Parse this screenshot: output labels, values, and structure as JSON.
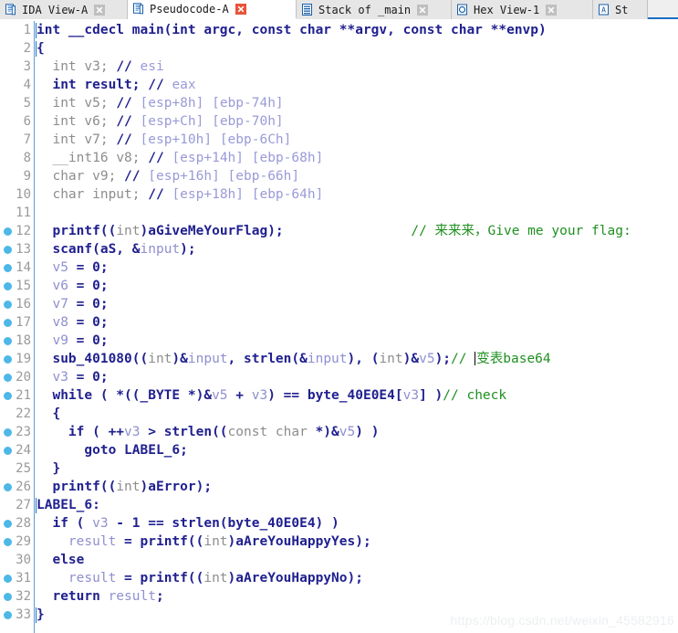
{
  "tabs": [
    {
      "label": "IDA View-A",
      "icon": "document-icon",
      "active": false,
      "close": "close-icon",
      "close_style": "gray",
      "width": 140
    },
    {
      "label": "Pseudocode-A",
      "icon": "document-icon",
      "active": true,
      "close": "close-icon",
      "close_style": "red",
      "width": 185
    },
    {
      "label": "Stack of _main",
      "icon": "stack-icon",
      "active": false,
      "close": "close-icon",
      "close_style": "gray",
      "width": 170
    },
    {
      "label": "Hex View-1",
      "icon": "hex-icon",
      "active": false,
      "close": "close-icon",
      "close_style": "gray",
      "width": 155
    },
    {
      "label": "St",
      "icon": "structures-icon",
      "active": false,
      "close": "",
      "close_style": "none",
      "width": 60
    }
  ],
  "colors": {
    "accent": "#1a6fc4",
    "breakpoint": "#4db8e8",
    "comment": "#1f9020",
    "keyword": "#202090",
    "variable": "#8f8fd0",
    "dim": "#8d8d8d",
    "linenum": "#9a9a9a",
    "gutter_rule": "#5b9bd5",
    "tab_active_bg": "#ffffff",
    "tab_inactive_bg": "#e6e6e6",
    "watermark": "#eceff1"
  },
  "watermark": "https://blog.csdn.net/weixin_45582916",
  "code_lines": [
    {
      "n": 1,
      "bp": false,
      "caret_left": true,
      "tokens": [
        {
          "t": "int __cdecl ",
          "c": "k"
        },
        {
          "t": "main(",
          "c": "k"
        },
        {
          "t": "int ",
          "c": "k"
        },
        {
          "t": "argc, ",
          "c": "k"
        },
        {
          "t": "const char ",
          "c": "k"
        },
        {
          "t": "**argv, ",
          "c": "k"
        },
        {
          "t": "const char ",
          "c": "k"
        },
        {
          "t": "**envp)",
          "c": "k"
        }
      ]
    },
    {
      "n": 2,
      "bp": false,
      "caret_left": true,
      "tokens": [
        {
          "t": "{",
          "c": "k"
        }
      ]
    },
    {
      "n": 3,
      "bp": false,
      "caret_left": false,
      "tokens": [
        {
          "t": "  int ",
          "c": "dim"
        },
        {
          "t": "v3",
          "c": "dim"
        },
        {
          "t": "; ",
          "c": "dim"
        },
        {
          "t": "// ",
          "c": "k"
        },
        {
          "t": "esi",
          "c": "cmv"
        }
      ]
    },
    {
      "n": 4,
      "bp": false,
      "caret_left": false,
      "tokens": [
        {
          "t": "  int ",
          "c": "k"
        },
        {
          "t": "result",
          "c": "k"
        },
        {
          "t": "; ",
          "c": "k"
        },
        {
          "t": "// ",
          "c": "k"
        },
        {
          "t": "eax",
          "c": "cmv"
        }
      ]
    },
    {
      "n": 5,
      "bp": false,
      "caret_left": false,
      "tokens": [
        {
          "t": "  int ",
          "c": "dim"
        },
        {
          "t": "v5",
          "c": "dim"
        },
        {
          "t": "; ",
          "c": "dim"
        },
        {
          "t": "// ",
          "c": "k"
        },
        {
          "t": "[esp+8h] [ebp-74h]",
          "c": "cmv"
        }
      ]
    },
    {
      "n": 6,
      "bp": false,
      "caret_left": false,
      "tokens": [
        {
          "t": "  int ",
          "c": "dim"
        },
        {
          "t": "v6",
          "c": "dim"
        },
        {
          "t": "; ",
          "c": "dim"
        },
        {
          "t": "// ",
          "c": "k"
        },
        {
          "t": "[esp+Ch] [ebp-70h]",
          "c": "cmv"
        }
      ]
    },
    {
      "n": 7,
      "bp": false,
      "caret_left": false,
      "tokens": [
        {
          "t": "  int ",
          "c": "dim"
        },
        {
          "t": "v7",
          "c": "dim"
        },
        {
          "t": "; ",
          "c": "dim"
        },
        {
          "t": "// ",
          "c": "k"
        },
        {
          "t": "[esp+10h] [ebp-6Ch]",
          "c": "cmv"
        }
      ]
    },
    {
      "n": 8,
      "bp": false,
      "caret_left": false,
      "tokens": [
        {
          "t": "  __int16 ",
          "c": "dim"
        },
        {
          "t": "v8",
          "c": "dim"
        },
        {
          "t": "; ",
          "c": "dim"
        },
        {
          "t": "// ",
          "c": "k"
        },
        {
          "t": "[esp+14h] [ebp-68h]",
          "c": "cmv"
        }
      ]
    },
    {
      "n": 9,
      "bp": false,
      "caret_left": false,
      "tokens": [
        {
          "t": "  char ",
          "c": "dim"
        },
        {
          "t": "v9",
          "c": "dim"
        },
        {
          "t": "; ",
          "c": "dim"
        },
        {
          "t": "// ",
          "c": "k"
        },
        {
          "t": "[esp+16h] [ebp-66h]",
          "c": "cmv"
        }
      ]
    },
    {
      "n": 10,
      "bp": false,
      "caret_left": false,
      "tokens": [
        {
          "t": "  char ",
          "c": "dim"
        },
        {
          "t": "input",
          "c": "dim"
        },
        {
          "t": "; ",
          "c": "dim"
        },
        {
          "t": "// ",
          "c": "k"
        },
        {
          "t": "[esp+18h] [ebp-64h]",
          "c": "cmv"
        }
      ]
    },
    {
      "n": 11,
      "bp": false,
      "caret_left": false,
      "tokens": []
    },
    {
      "n": 12,
      "bp": true,
      "caret_left": false,
      "tokens": [
        {
          "t": "  printf((",
          "c": "k"
        },
        {
          "t": "int",
          "c": "dim"
        },
        {
          "t": ")aGiveMeYourFlag);",
          "c": "k"
        },
        {
          "t": "                ",
          "c": "pl"
        },
        {
          "t": "// 来来来，Give me your flag:",
          "c": "cm"
        }
      ]
    },
    {
      "n": 13,
      "bp": true,
      "caret_left": false,
      "tokens": [
        {
          "t": "  scanf(aS, &",
          "c": "k"
        },
        {
          "t": "input",
          "c": "var"
        },
        {
          "t": ");",
          "c": "k"
        }
      ]
    },
    {
      "n": 14,
      "bp": true,
      "caret_left": false,
      "tokens": [
        {
          "t": "  ",
          "c": "pl"
        },
        {
          "t": "v5",
          "c": "var"
        },
        {
          "t": " = 0;",
          "c": "k"
        }
      ]
    },
    {
      "n": 15,
      "bp": true,
      "caret_left": false,
      "tokens": [
        {
          "t": "  ",
          "c": "pl"
        },
        {
          "t": "v6",
          "c": "var"
        },
        {
          "t": " = 0;",
          "c": "k"
        }
      ]
    },
    {
      "n": 16,
      "bp": true,
      "caret_left": false,
      "tokens": [
        {
          "t": "  ",
          "c": "pl"
        },
        {
          "t": "v7",
          "c": "var"
        },
        {
          "t": " = 0;",
          "c": "k"
        }
      ]
    },
    {
      "n": 17,
      "bp": true,
      "caret_left": false,
      "tokens": [
        {
          "t": "  ",
          "c": "pl"
        },
        {
          "t": "v8",
          "c": "var"
        },
        {
          "t": " = 0;",
          "c": "k"
        }
      ]
    },
    {
      "n": 18,
      "bp": true,
      "caret_left": false,
      "tokens": [
        {
          "t": "  ",
          "c": "pl"
        },
        {
          "t": "v9",
          "c": "var"
        },
        {
          "t": " = 0;",
          "c": "k"
        }
      ]
    },
    {
      "n": 19,
      "bp": true,
      "caret_left": false,
      "caret_inline": true,
      "tokens": [
        {
          "t": "  sub_401080((",
          "c": "k"
        },
        {
          "t": "int",
          "c": "dim"
        },
        {
          "t": ")&",
          "c": "k"
        },
        {
          "t": "input",
          "c": "var"
        },
        {
          "t": ", strlen(&",
          "c": "k"
        },
        {
          "t": "input",
          "c": "var"
        },
        {
          "t": "), (",
          "c": "k"
        },
        {
          "t": "int",
          "c": "dim"
        },
        {
          "t": ")&",
          "c": "k"
        },
        {
          "t": "v5",
          "c": "var"
        },
        {
          "t": ");",
          "c": "k"
        },
        {
          "t": "// ",
          "c": "cm"
        },
        {
          "t": "CARET",
          "c": "caret"
        },
        {
          "t": "变表base64",
          "c": "cm"
        }
      ]
    },
    {
      "n": 20,
      "bp": true,
      "caret_left": false,
      "tokens": [
        {
          "t": "  ",
          "c": "pl"
        },
        {
          "t": "v3",
          "c": "var"
        },
        {
          "t": " = 0;",
          "c": "k"
        }
      ]
    },
    {
      "n": 21,
      "bp": true,
      "caret_left": false,
      "tokens": [
        {
          "t": "  while ( *((_BYTE *)&",
          "c": "k"
        },
        {
          "t": "v5",
          "c": "var"
        },
        {
          "t": " + ",
          "c": "k"
        },
        {
          "t": "v3",
          "c": "var"
        },
        {
          "t": ") == byte_40E0E4[",
          "c": "k"
        },
        {
          "t": "v3",
          "c": "var"
        },
        {
          "t": "] )",
          "c": "k"
        },
        {
          "t": "// check",
          "c": "cm"
        }
      ]
    },
    {
      "n": 22,
      "bp": false,
      "caret_left": false,
      "tokens": [
        {
          "t": "  {",
          "c": "k"
        }
      ]
    },
    {
      "n": 23,
      "bp": true,
      "caret_left": false,
      "tokens": [
        {
          "t": "    if ( ++",
          "c": "k"
        },
        {
          "t": "v3",
          "c": "var"
        },
        {
          "t": " > strlen((",
          "c": "k"
        },
        {
          "t": "const char ",
          "c": "dim"
        },
        {
          "t": "*)&",
          "c": "k"
        },
        {
          "t": "v5",
          "c": "var"
        },
        {
          "t": ") )",
          "c": "k"
        }
      ]
    },
    {
      "n": 24,
      "bp": true,
      "caret_left": false,
      "tokens": [
        {
          "t": "      goto LABEL_6;",
          "c": "k"
        }
      ]
    },
    {
      "n": 25,
      "bp": false,
      "caret_left": false,
      "tokens": [
        {
          "t": "  }",
          "c": "k"
        }
      ]
    },
    {
      "n": 26,
      "bp": true,
      "caret_left": false,
      "tokens": [
        {
          "t": "  printf((",
          "c": "k"
        },
        {
          "t": "int",
          "c": "dim"
        },
        {
          "t": ")aError);",
          "c": "k"
        }
      ]
    },
    {
      "n": 27,
      "bp": false,
      "caret_left": true,
      "tokens": [
        {
          "t": "LABEL_6:",
          "c": "k"
        }
      ]
    },
    {
      "n": 28,
      "bp": true,
      "caret_left": false,
      "tokens": [
        {
          "t": "  if ( ",
          "c": "k"
        },
        {
          "t": "v3",
          "c": "var"
        },
        {
          "t": " - 1 == strlen(byte_40E0E4) )",
          "c": "k"
        }
      ]
    },
    {
      "n": 29,
      "bp": true,
      "caret_left": false,
      "tokens": [
        {
          "t": "    ",
          "c": "pl"
        },
        {
          "t": "result",
          "c": "var"
        },
        {
          "t": " = printf((",
          "c": "k"
        },
        {
          "t": "int",
          "c": "dim"
        },
        {
          "t": ")aAreYouHappyYes);",
          "c": "k"
        }
      ]
    },
    {
      "n": 30,
      "bp": false,
      "caret_left": false,
      "tokens": [
        {
          "t": "  else",
          "c": "k"
        }
      ]
    },
    {
      "n": 31,
      "bp": true,
      "caret_left": false,
      "tokens": [
        {
          "t": "    ",
          "c": "pl"
        },
        {
          "t": "result",
          "c": "var"
        },
        {
          "t": " = printf((",
          "c": "k"
        },
        {
          "t": "int",
          "c": "dim"
        },
        {
          "t": ")aAreYouHappyNo);",
          "c": "k"
        }
      ]
    },
    {
      "n": 32,
      "bp": true,
      "caret_left": false,
      "tokens": [
        {
          "t": "  return ",
          "c": "k"
        },
        {
          "t": "result",
          "c": "var"
        },
        {
          "t": ";",
          "c": "k"
        }
      ]
    },
    {
      "n": 33,
      "bp": true,
      "caret_left": true,
      "tokens": [
        {
          "t": "}",
          "c": "k"
        }
      ]
    }
  ]
}
